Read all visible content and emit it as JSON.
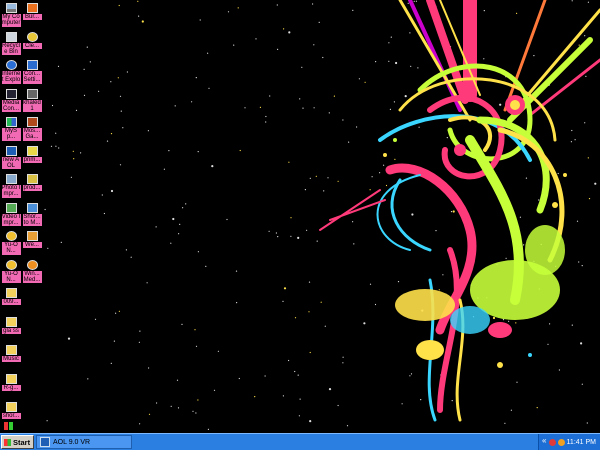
{
  "desktop": {
    "column1": [
      {
        "label": "My Computer",
        "icon": "my-computer-icon"
      },
      {
        "label": "Recycle Bin",
        "icon": "recycle-bin-icon"
      },
      {
        "label": "Internet Explorer",
        "icon": "internet-explorer-icon"
      },
      {
        "label": "Media Con...",
        "icon": "media-center-icon"
      },
      {
        "label": "MySp...",
        "icon": "msn-icon"
      },
      {
        "label": "new AOL",
        "icon": "aol-icon"
      },
      {
        "label": "Photo Impr...",
        "icon": "photo-impression-icon"
      },
      {
        "label": "Video Impr...",
        "icon": "video-impression-icon"
      },
      {
        "label": "Yu-ON...",
        "icon": "yu-icon"
      },
      {
        "label": "Yu-ON...",
        "icon": "yu-icon"
      },
      {
        "label": "009...",
        "icon": "folder-icon"
      },
      {
        "label": "gla ss",
        "icon": "folder-icon"
      },
      {
        "label": "Music",
        "icon": "folder-icon"
      },
      {
        "label": "R-g...",
        "icon": "folder-icon"
      },
      {
        "label": "shor...",
        "icon": "folder-icon"
      }
    ],
    "column2": [
      {
        "label": "Bur...",
        "icon": "burn-icon"
      },
      {
        "label": "Cle...",
        "icon": "cleaner-icon"
      },
      {
        "label": "Con... Setti...",
        "icon": "connection-settings-icon"
      },
      {
        "label": "khaled1",
        "icon": "user-icon"
      },
      {
        "label": "Mos... Ga...",
        "icon": "game-icon"
      },
      {
        "label": "prim...",
        "icon": "primo-icon"
      },
      {
        "label": "prod...",
        "icon": "product-icon"
      },
      {
        "label": "Shor... to M...",
        "icon": "shortcut-icon"
      },
      {
        "label": "We...",
        "icon": "web-icon"
      },
      {
        "label": "Win... Med...",
        "icon": "windows-media-icon"
      }
    ]
  },
  "taskbar": {
    "start_label": "Start",
    "tasks": [
      {
        "label": "AOL 9.0 VR",
        "icon": "aol-icon"
      }
    ],
    "tray": {
      "chevron": "«",
      "clock": "11:41 PM"
    }
  },
  "colors": {
    "taskbar": "#2a7fe0",
    "icon_label_bg": "#f36ab4",
    "desktop_bg": "#000000"
  }
}
